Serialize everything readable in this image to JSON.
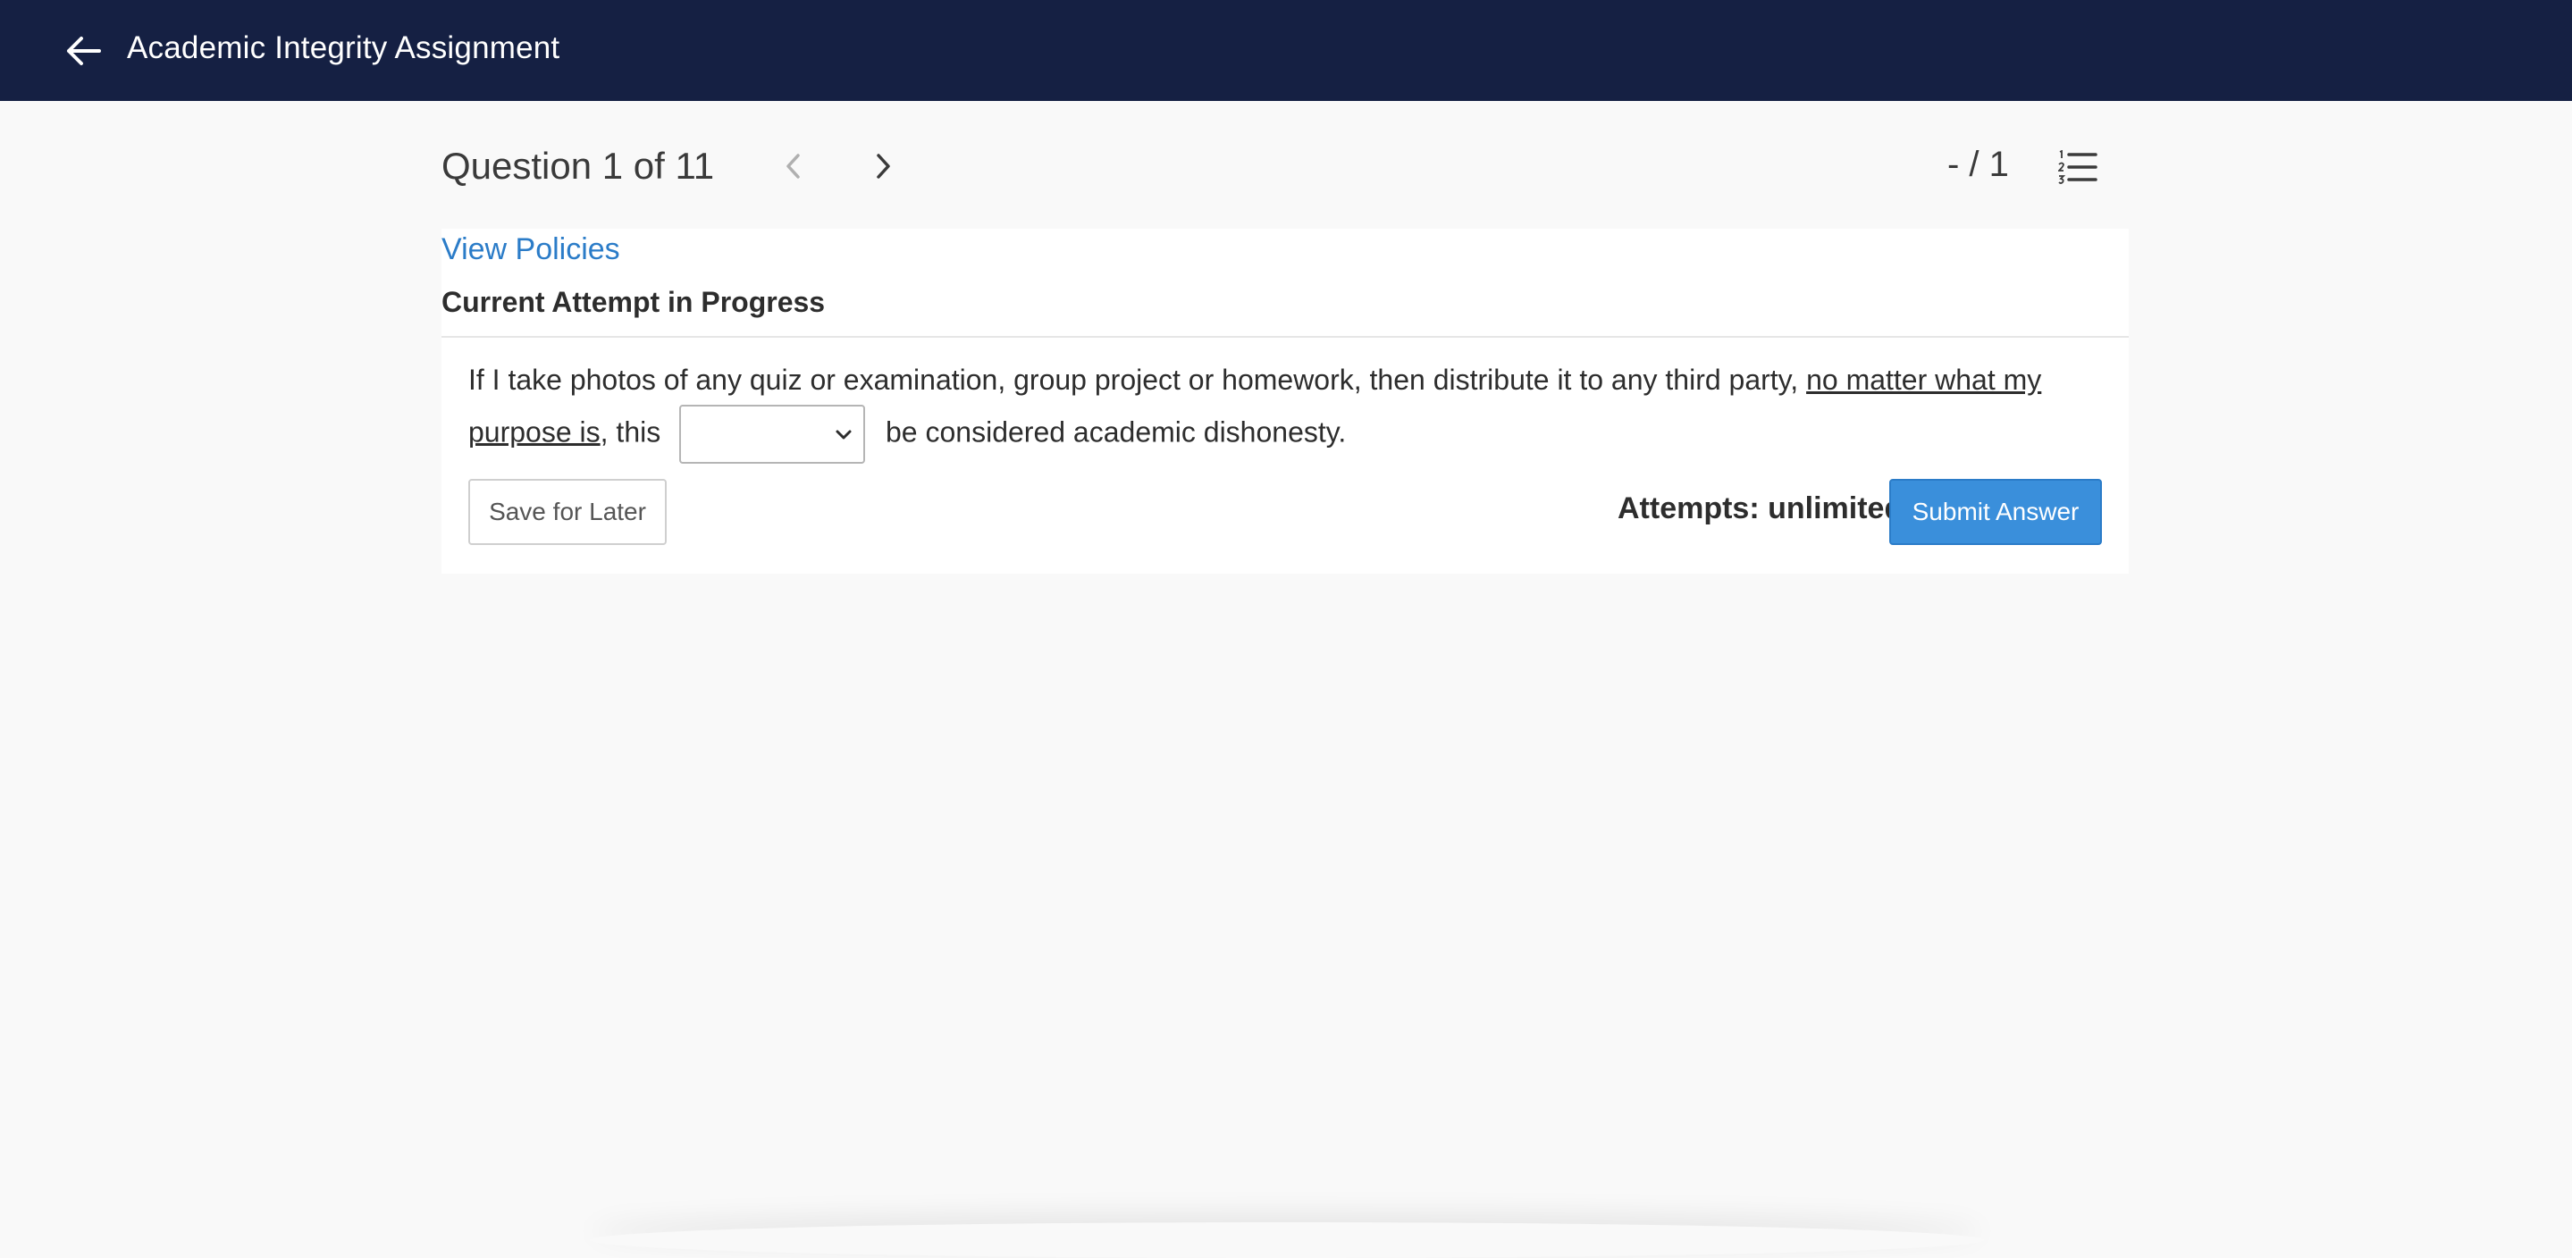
{
  "header": {
    "back_icon": "arrow-left-icon",
    "title": "Academic Integrity Assignment"
  },
  "question_nav": {
    "label": "Question 1 of 11",
    "prev_icon": "chevron-left-icon",
    "next_icon": "chevron-right-icon",
    "score": "- / 1",
    "list_icon": "numbered-list-icon"
  },
  "card": {
    "policies_link": "View Policies",
    "attempt_status": "Current Attempt in Progress",
    "question": {
      "part1": "If I take photos of any quiz or examination, group project or homework, then distribute it to any third party, ",
      "underlined": "no matter what my purpose is",
      "part2": ", this",
      "part3": "be considered academic dishonesty."
    },
    "answer_select_value": "",
    "save_label": "Save for Later",
    "attempts": "Attempts: unlimited",
    "submit_label": "Submit Answer"
  },
  "colors": {
    "topbar": "#152043",
    "link": "#2b7cc8",
    "submit": "#3a8fdb",
    "background": "#f9f9f9"
  }
}
